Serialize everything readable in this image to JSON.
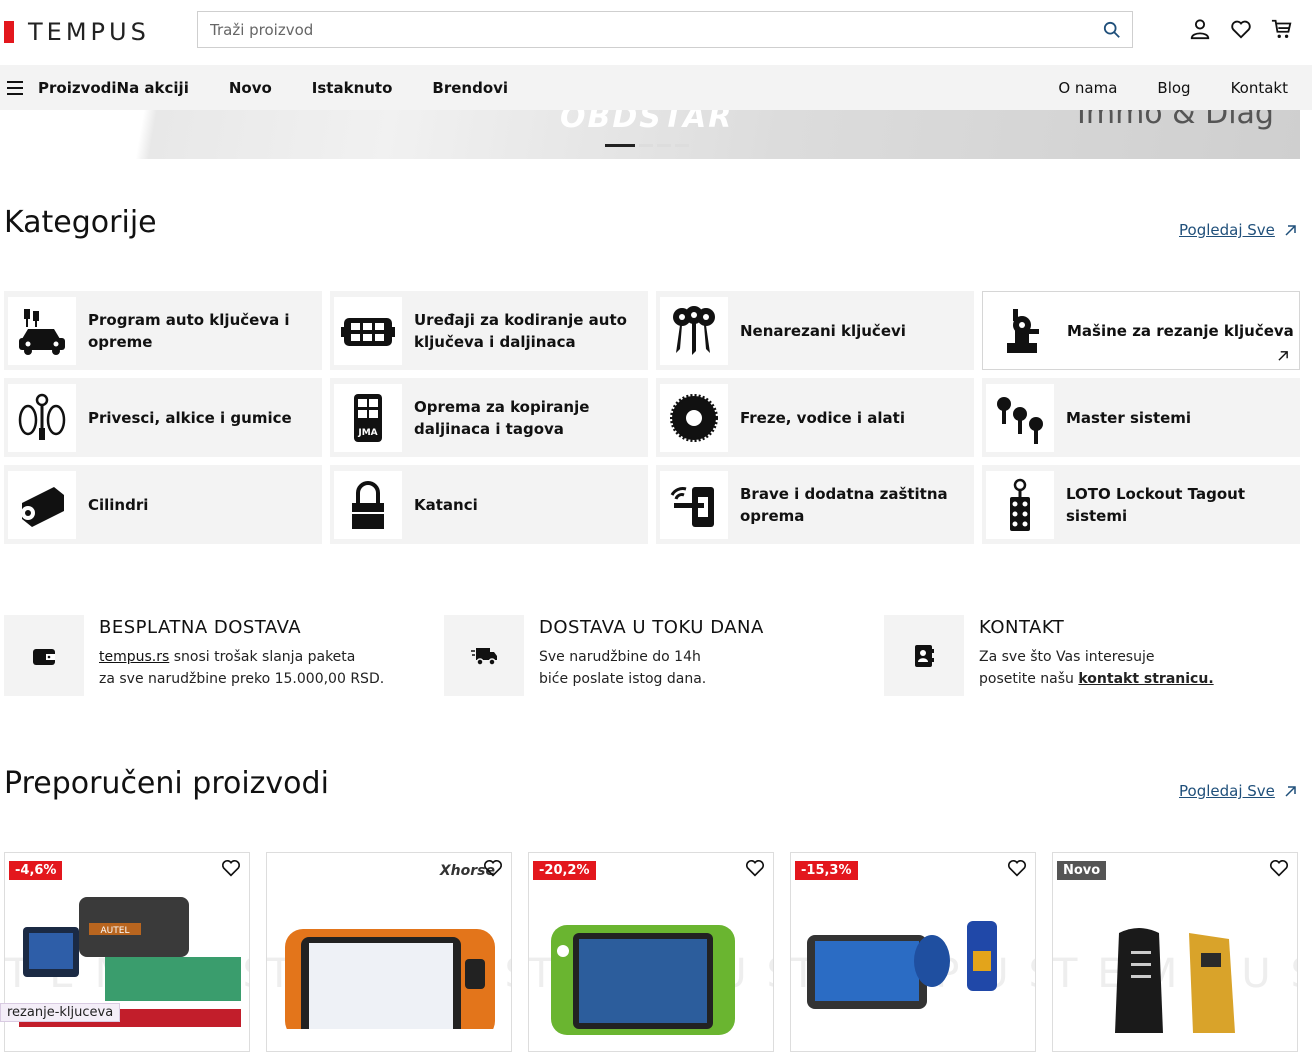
{
  "header": {
    "logo_text": "TEMPUS",
    "search_placeholder": "Traži proizvod"
  },
  "nav": {
    "menu_label": "Proizvodi",
    "items": [
      "Na akciji",
      "Novo",
      "Istaknuto",
      "Brendovi"
    ],
    "right_items": [
      "O nama",
      "Blog",
      "Kontakt"
    ]
  },
  "banner": {
    "text": "Immo & Diag"
  },
  "categories": {
    "title": "Kategorije",
    "see_all": "Pogledaj Sve",
    "items": [
      {
        "label": "Program auto ključeva i opreme",
        "icon": "car-key-icon"
      },
      {
        "label": "Uređaji za kodiranje auto ključeva i daljinaca",
        "icon": "programmer-device-icon"
      },
      {
        "label": "Nenarezani ključevi",
        "icon": "key-blanks-icon"
      },
      {
        "label": "Mašine za rezanje ključeva",
        "icon": "key-cutting-machine-icon"
      },
      {
        "label": "Privesci, alkice i gumice",
        "icon": "keyring-icon"
      },
      {
        "label": "Oprema za kopiranje daljinaca i tagova",
        "icon": "remote-copier-icon"
      },
      {
        "label": "Freze, vodice i alati",
        "icon": "cutter-wheel-icon"
      },
      {
        "label": "Master sistemi",
        "icon": "master-keys-icon"
      },
      {
        "label": "Cilindri",
        "icon": "cylinder-lock-icon"
      },
      {
        "label": "Katanci",
        "icon": "padlock-icon"
      },
      {
        "label": "Brave i dodatna zaštitna oprema",
        "icon": "smart-lock-icon"
      },
      {
        "label": "LOTO Lockout Tagout sistemi",
        "icon": "lockout-tag-icon"
      }
    ]
  },
  "info": [
    {
      "title": "BESPLATNA DOSTAVA",
      "line1_link": "tempus.rs",
      "line1_rest": " snosi trošak slanja paketa",
      "line2": "za sve narudžbine preko 15.000,00 RSD.",
      "icon": "wallet-icon"
    },
    {
      "title": "DOSTAVA U TOKU DANA",
      "line1": "Sve narudžbine do 14h",
      "line2": "biće poslate istog dana.",
      "icon": "delivery-truck-icon"
    },
    {
      "title": "KONTAKT",
      "line1": "Za sve što Vas interesuje",
      "line2_pre": "posetite našu ",
      "line2_link": "kontakt stranicu.",
      "icon": "contact-book-icon"
    }
  ],
  "recommended": {
    "title": "Preporučeni proizvodi",
    "see_all": "Pogledaj Sve",
    "products": [
      {
        "badge": "-4,6%"
      },
      {
        "badge": "",
        "brand": "Xhorse"
      },
      {
        "badge": "-20,2%"
      },
      {
        "badge": "-15,3%"
      },
      {
        "badge": "Novo"
      }
    ],
    "watermark": "TEMPUS"
  },
  "status_bar": "rezanje-kljuceva"
}
